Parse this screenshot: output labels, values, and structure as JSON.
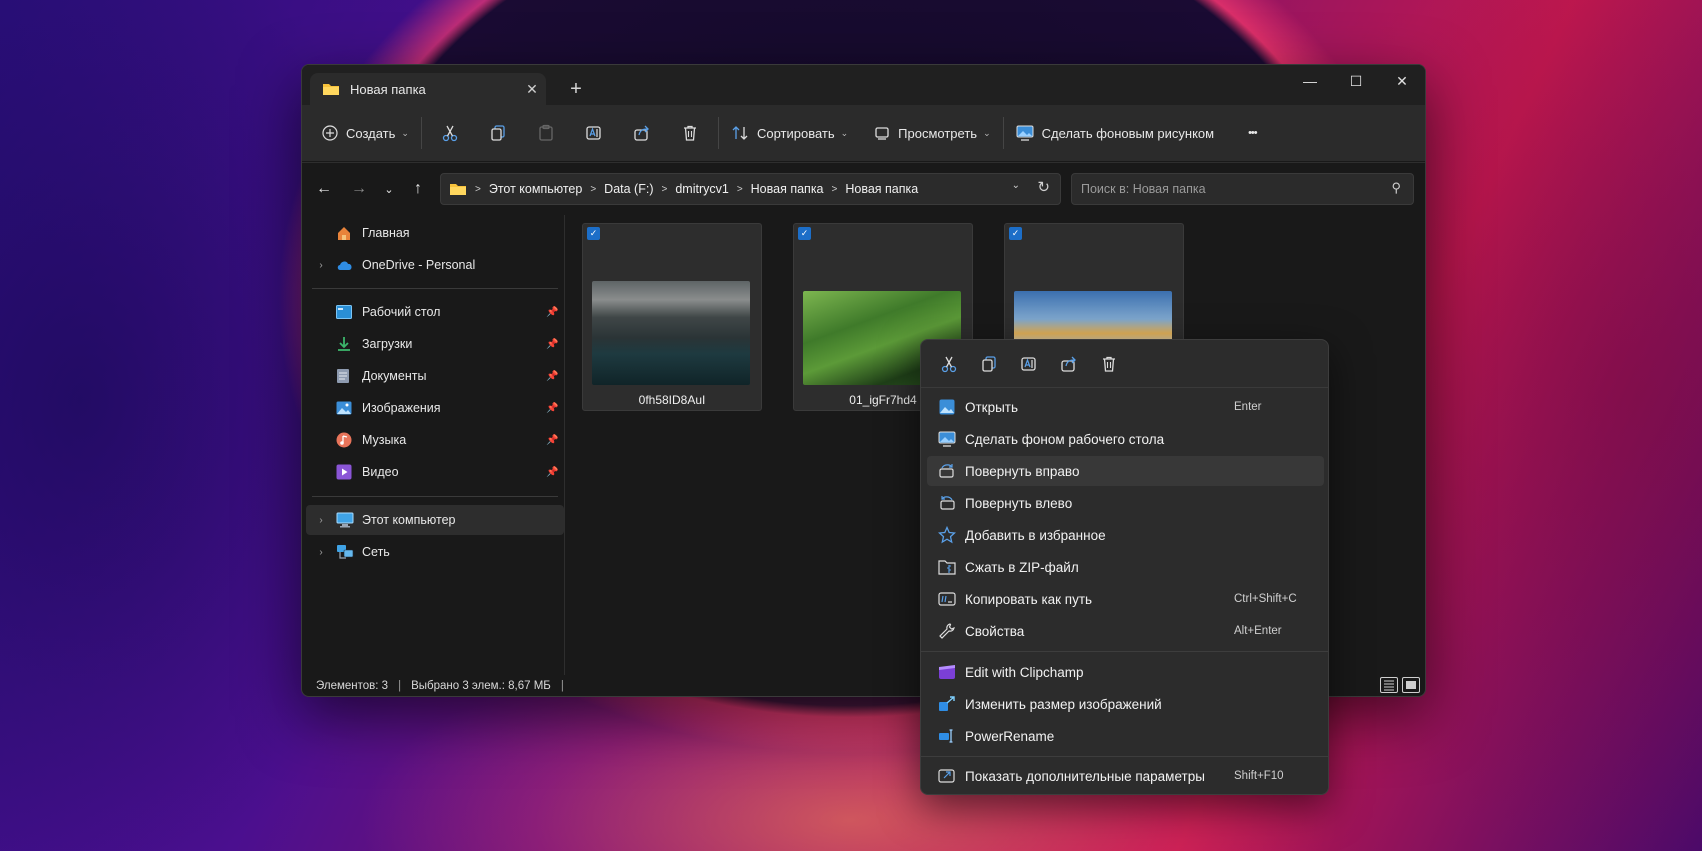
{
  "window": {
    "tab_title": "Новая папка",
    "new_tab": "+",
    "minimize": "—",
    "maximize": "☐",
    "close": "✕"
  },
  "toolbar": {
    "create_label": "Создать",
    "sort_label": "Сортировать",
    "view_label": "Просмотреть",
    "wallpaper_label": "Сделать фоновым рисунком",
    "more_label": "•••"
  },
  "address": {
    "crumbs": [
      "Этот компьютер",
      "Data (F:)",
      "dmitrycv1",
      "Новая папка",
      "Новая папка"
    ],
    "search_placeholder": "Поиск в: Новая папка"
  },
  "sidebar": {
    "items": [
      {
        "label": "Главная",
        "icon": "home-icon"
      },
      {
        "label": "OneDrive - Personal",
        "icon": "cloud-icon"
      },
      {
        "label": "Рабочий стол",
        "icon": "desktop-icon"
      },
      {
        "label": "Загрузки",
        "icon": "download-icon"
      },
      {
        "label": "Документы",
        "icon": "document-icon"
      },
      {
        "label": "Изображения",
        "icon": "pictures-icon"
      },
      {
        "label": "Музыка",
        "icon": "music-icon"
      },
      {
        "label": "Видео",
        "icon": "video-icon"
      },
      {
        "label": "Этот компьютер",
        "icon": "computer-icon"
      },
      {
        "label": "Сеть",
        "icon": "network-icon"
      }
    ]
  },
  "files": [
    {
      "name": "0fh58ID8AuI",
      "checked": true
    },
    {
      "name": "01_igFr7hd4",
      "checked": true
    },
    {
      "name": "",
      "checked": true
    }
  ],
  "status": {
    "count": "Элементов: 3",
    "selected": "Выбрано 3 элем.: 8,67 МБ"
  },
  "context_menu": {
    "items": [
      {
        "label": "Открыть",
        "shortcut": "Enter",
        "icon": "open-icon"
      },
      {
        "label": "Сделать фоном рабочего стола",
        "shortcut": "",
        "icon": "wallpaper-icon"
      },
      {
        "label": "Повернуть вправо",
        "shortcut": "",
        "icon": "rotate-right-icon"
      },
      {
        "label": "Повернуть влево",
        "shortcut": "",
        "icon": "rotate-left-icon"
      },
      {
        "label": "Добавить в избранное",
        "shortcut": "",
        "icon": "star-icon"
      },
      {
        "label": "Сжать в ZIP-файл",
        "shortcut": "",
        "icon": "zip-icon"
      },
      {
        "label": "Копировать как путь",
        "shortcut": "Ctrl+Shift+C",
        "icon": "copy-path-icon"
      },
      {
        "label": "Свойства",
        "shortcut": "Alt+Enter",
        "icon": "wrench-icon"
      },
      {
        "label": "Edit with Clipchamp",
        "shortcut": "",
        "icon": "clipchamp-icon"
      },
      {
        "label": "Изменить размер изображений",
        "shortcut": "",
        "icon": "resize-icon"
      },
      {
        "label": "PowerRename",
        "shortcut": "",
        "icon": "powerrename-icon"
      },
      {
        "label": "Показать дополнительные параметры",
        "shortcut": "Shift+F10",
        "icon": "more-options-icon"
      }
    ]
  },
  "colors": {
    "accent": "#1c6ec8",
    "window_bg": "#191919",
    "toolbar_bg": "#2b2b2b",
    "menu_bg": "#2c2c2c"
  }
}
